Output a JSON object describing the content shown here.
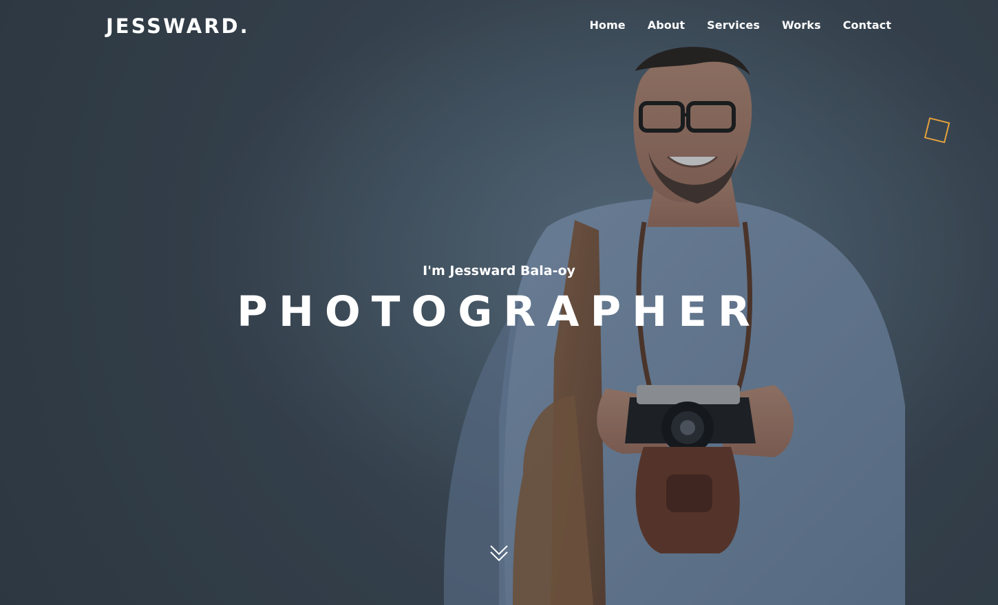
{
  "brand": {
    "logo": "JESSWARD."
  },
  "nav": {
    "items": [
      "Home",
      "About",
      "Services",
      "Works",
      "Contact"
    ]
  },
  "hero": {
    "intro": "I'm Jessward Bala-oy",
    "title": "PHOTOGRAPHER"
  },
  "decor": {
    "accent_square": "#e6a23c"
  },
  "icons": {
    "scroll": "double-chevron-down-icon"
  }
}
